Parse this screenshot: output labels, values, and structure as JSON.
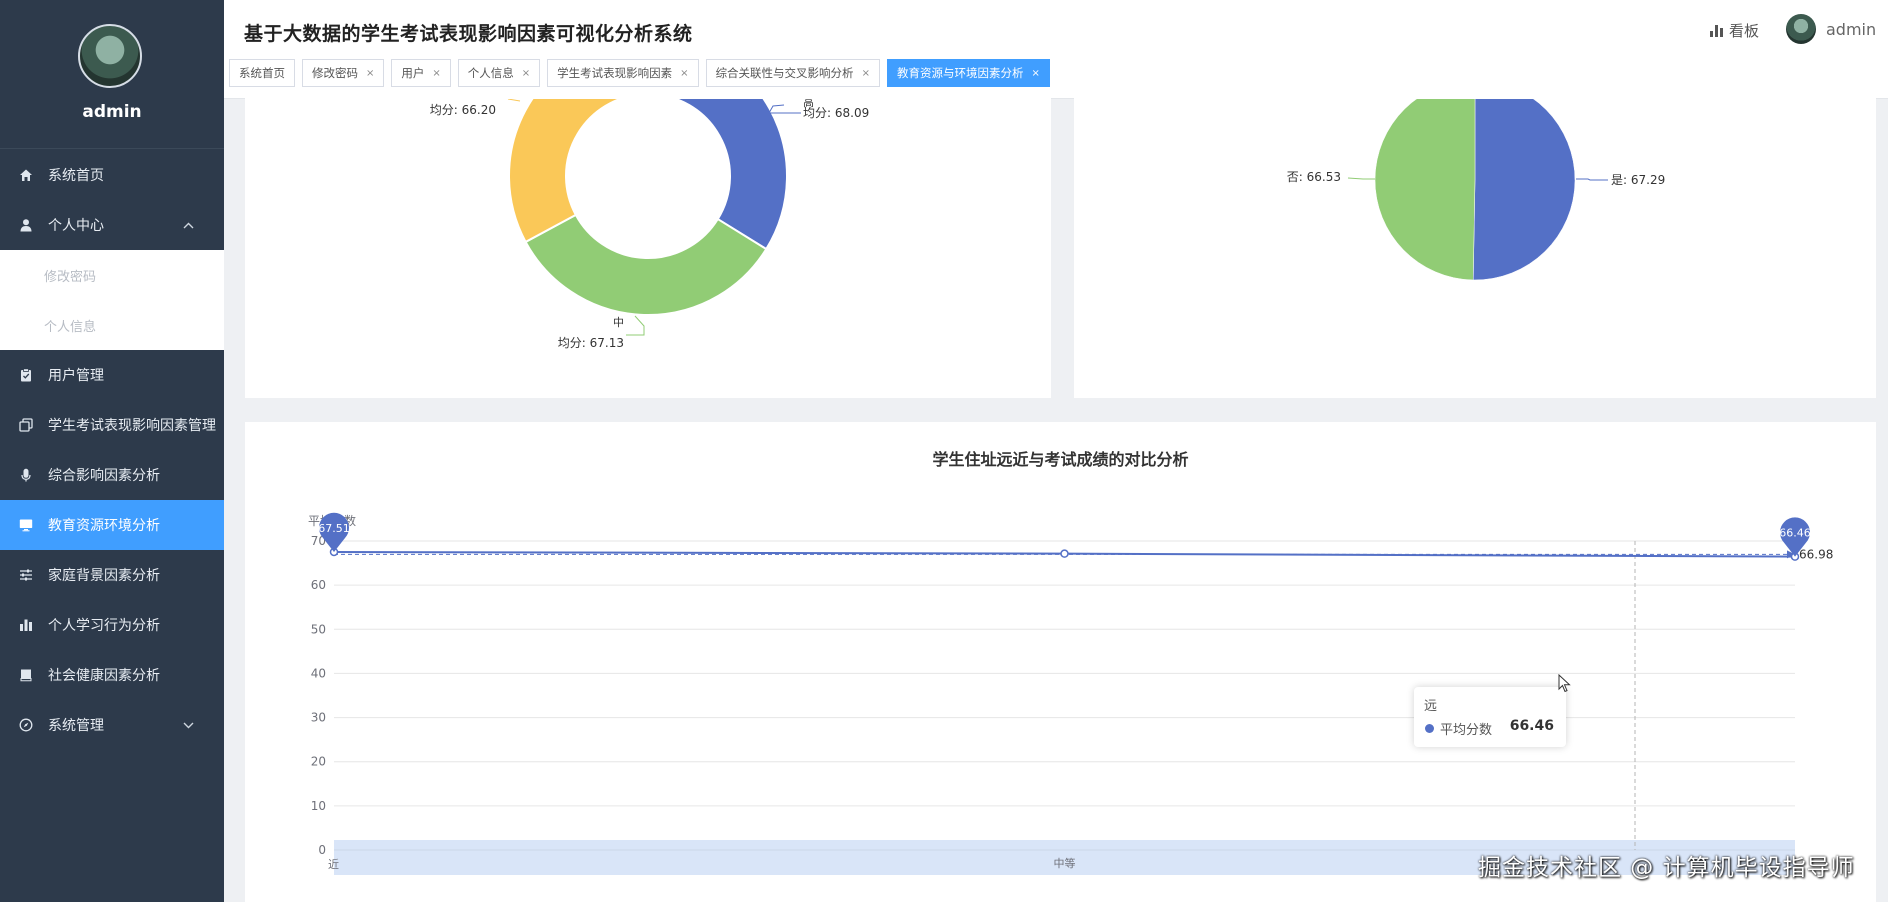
{
  "app": {
    "title": "基于大数据的学生考试表现影响因素可视化分析系统",
    "board_label": "看板",
    "user_name": "admin"
  },
  "profile": {
    "name": "admin"
  },
  "sidebar": {
    "items": [
      {
        "label": "系统首页",
        "icon": "home-icon"
      },
      {
        "label": "个人中心",
        "icon": "user-icon",
        "expanded": true
      },
      {
        "label": "用户管理",
        "icon": "clipboard-icon"
      },
      {
        "label": "学生考试表现影响因素管理",
        "icon": "copy-icon"
      },
      {
        "label": "综合影响因素分析",
        "icon": "microphone-icon"
      },
      {
        "label": "教育资源环境分析",
        "icon": "monitor-icon",
        "active": true
      },
      {
        "label": "家庭背景因素分析",
        "icon": "sliders-icon"
      },
      {
        "label": "个人学习行为分析",
        "icon": "bar-chart-icon"
      },
      {
        "label": "社会健康因素分析",
        "icon": "bookmark-icon"
      },
      {
        "label": "系统管理",
        "icon": "compass-icon"
      }
    ],
    "submenu": [
      "修改密码",
      "个人信息"
    ]
  },
  "tabs": [
    {
      "label": "系统首页",
      "closable": false
    },
    {
      "label": "修改密码",
      "closable": true
    },
    {
      "label": "用户",
      "closable": true
    },
    {
      "label": "个人信息",
      "closable": true
    },
    {
      "label": "学生考试表现影响因素",
      "closable": true
    },
    {
      "label": "综合关联性与交叉影响分析",
      "closable": true
    },
    {
      "label": "教育资源与环境因素分析",
      "closable": true,
      "active": true
    }
  ],
  "tab_close_glyph": "×",
  "colors": {
    "accent": "#409eff",
    "sidebar": "#2d3a4b",
    "blue": "#5470c6",
    "green": "#91cc75",
    "yellow": "#fac858"
  },
  "chart_data": [
    {
      "type": "pie",
      "variant": "donut",
      "slices": [
        {
          "name": "高",
          "label": "均分: 68.09",
          "value": 68.09,
          "color": "#5470c6"
        },
        {
          "name": "中",
          "label": "均分: 67.13",
          "value": 67.13,
          "color": "#91cc75"
        },
        {
          "name": "",
          "label": "均分: 66.20",
          "value": 66.2,
          "color": "#fac858"
        }
      ],
      "partially_visible": true
    },
    {
      "type": "pie",
      "slices": [
        {
          "name": "是",
          "label": "是: 67.29",
          "value": 67.29,
          "color": "#5470c6"
        },
        {
          "name": "否",
          "label": "否: 66.53",
          "value": 66.53,
          "color": "#91cc75"
        }
      ],
      "partially_visible": true
    },
    {
      "type": "line",
      "title": "学生住址远近与考试成绩的对比分析",
      "ylabel": "平均分数",
      "categories": [
        "近",
        "中等",
        "远"
      ],
      "series": [
        {
          "name": "平均分数",
          "values": [
            67.51,
            67.13,
            66.46
          ],
          "color": "#5470c6"
        }
      ],
      "ylim": [
        0,
        70
      ],
      "yticks": [
        0,
        10,
        20,
        30,
        40,
        50,
        60,
        70
      ],
      "markpoints": [
        {
          "label": "67.51",
          "type": "max"
        },
        {
          "label": "66.46",
          "type": "min"
        }
      ],
      "markline": {
        "label": "66.98",
        "value": 66.98
      },
      "tooltip": {
        "category": "远",
        "series": "平均分数",
        "value": "66.46"
      },
      "datazoom_label": "中等"
    }
  ],
  "watermark": "掘金技术社区 @ 计算机毕设指导师"
}
